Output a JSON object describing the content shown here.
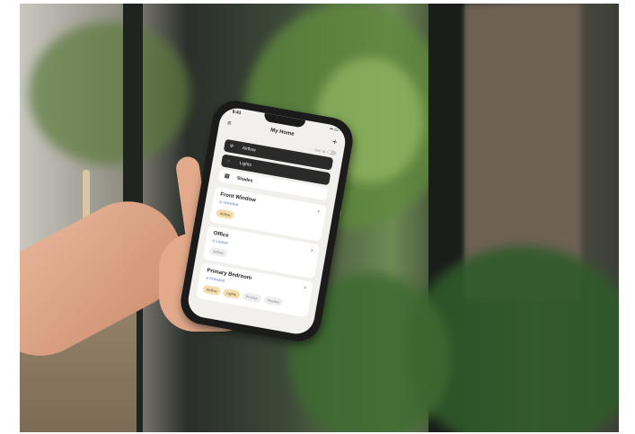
{
  "phone": {
    "status_time": "9:41",
    "status_icons": "▪▪ ▭",
    "header": {
      "title": "My Home",
      "menu_icon": "hamburger-menu-icon",
      "add_icon": "plus-icon"
    },
    "toggle_label": "See all",
    "quick_controls": [
      {
        "label": "Airflow",
        "icon": "fan-icon"
      },
      {
        "label": "Lights",
        "icon": "bulb-icon"
      },
      {
        "label": "Shades",
        "icon": "shade-icon"
      }
    ],
    "rooms": [
      {
        "name": "Front Window",
        "status": "◎ Unlocked",
        "chips": [
          {
            "label": "Airflow",
            "active": true
          }
        ]
      },
      {
        "name": "Office",
        "status": "◎ Locked",
        "chips": [
          {
            "label": "Airflow",
            "active": false
          }
        ]
      },
      {
        "name": "Primary Bedroom",
        "status": "◎ Unlocked",
        "chips": [
          {
            "label": "Airflow",
            "active": true
          },
          {
            "label": "Lights",
            "active": true
          },
          {
            "label": "Privacy",
            "active": false
          },
          {
            "label": "Shades",
            "active": false
          }
        ]
      }
    ]
  },
  "colors": {
    "accent_chip": "#f3dfae",
    "dark_row": "#2a2a2a",
    "status_blue": "#4a6fb0"
  }
}
